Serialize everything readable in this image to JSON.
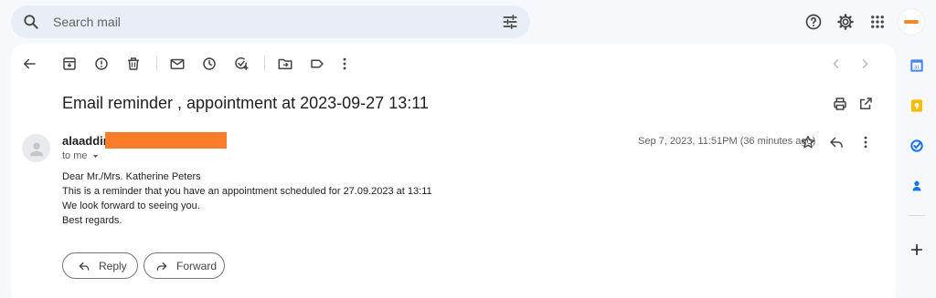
{
  "search": {
    "placeholder": "Search mail"
  },
  "toolbar": {
    "icons": [
      "back-arrow-icon",
      "archive-icon",
      "report-spam-icon",
      "delete-icon",
      "mark-unread-icon",
      "snooze-icon",
      "add-task-icon",
      "move-to-icon",
      "label-icon",
      "more-vert-icon",
      "older-chevron-icon",
      "newer-chevron-icon"
    ]
  },
  "email": {
    "subject": "Email reminder , appointment at 2023-09-27 13:11",
    "sender_name": "alaaddin",
    "to_label": "to me",
    "date": "Sep 7, 2023, 11:51PM (36 minutes ago)",
    "body": [
      "Dear Mr./Mrs. Katherine Peters",
      "This is a reminder that you have an appointment scheduled for 27.09.2023 at 13:11",
      "We look forward to seeing you.",
      "Best regards."
    ]
  },
  "actions": {
    "reply": "Reply",
    "forward": "Forward"
  },
  "colors": {
    "redaction": "#fb7d2a",
    "background": "#f6f8fc",
    "search_bg": "#e9eef6"
  },
  "right_rail": {
    "icons": [
      "calendar-icon",
      "keep-icon",
      "tasks-icon",
      "contacts-icon",
      "add-icon"
    ],
    "calendar_day": "31"
  }
}
